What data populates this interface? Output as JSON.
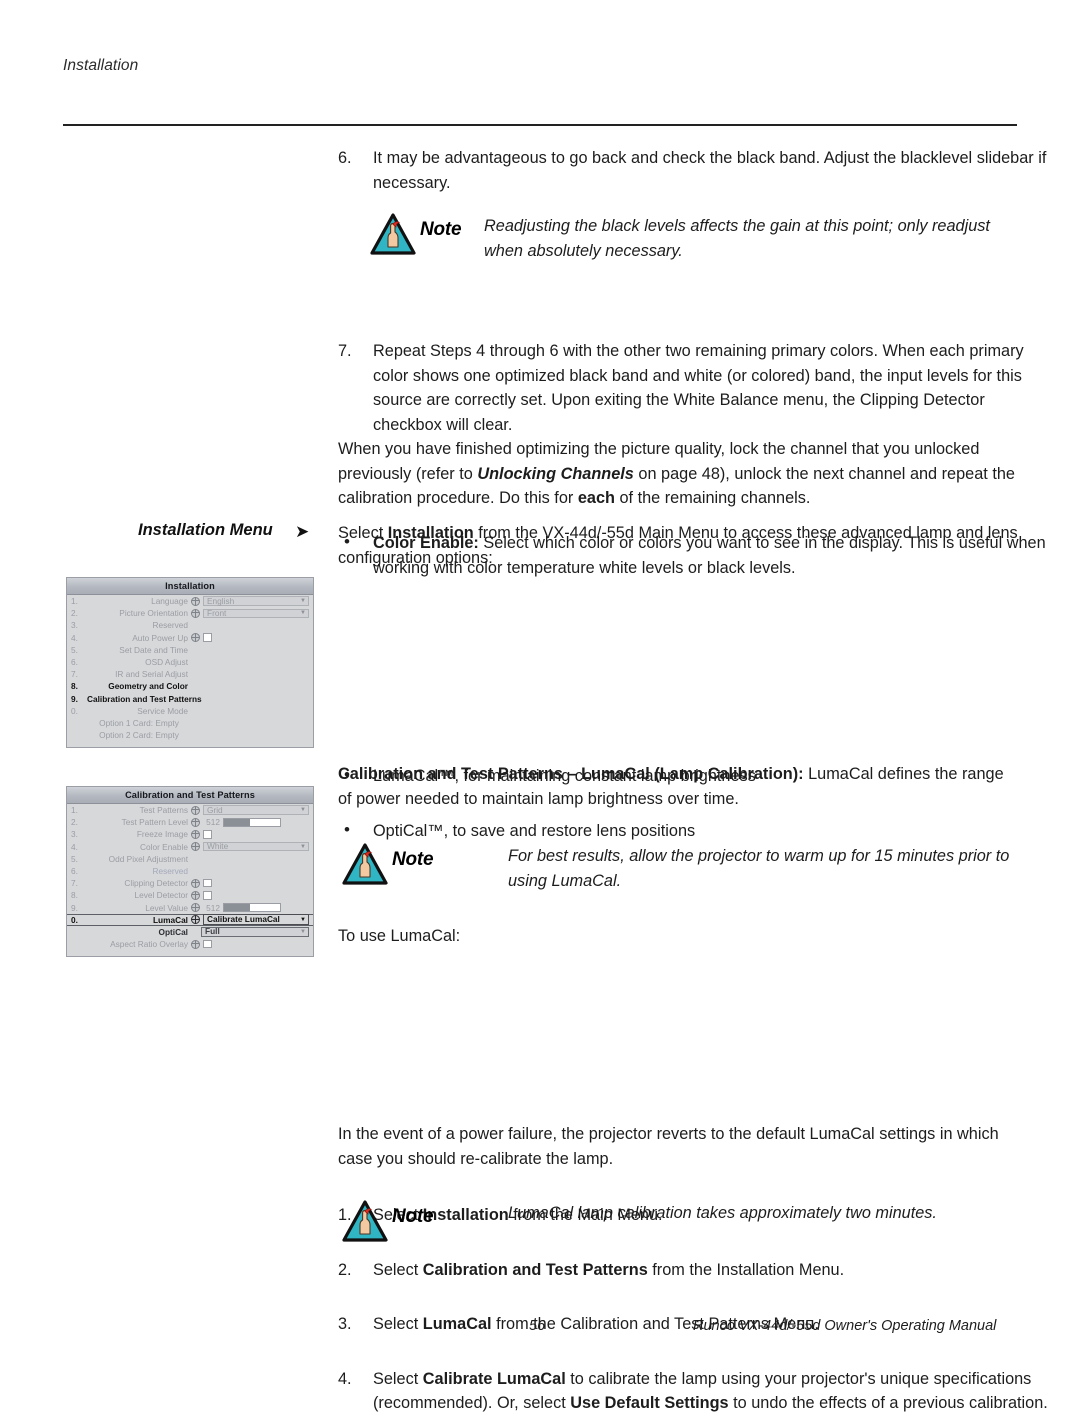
{
  "page": {
    "running_head": "Installation",
    "footer_page_number": "56",
    "footer_title": "Runco VX-44d/-55d Owner's Operating Manual"
  },
  "content": {
    "step6": {
      "marker": "6.",
      "text": "It may be advantageous to go back and check the black band. Adjust the blacklevel slidebar if necessary."
    },
    "note1": {
      "label": "Note",
      "text": "Readjusting the black levels affects the gain at this point; only readjust when absolutely necessary."
    },
    "step7": {
      "marker": "7.",
      "text": "Repeat Steps 4 through 6 with the other two remaining primary colors. When each primary color shows one optimized black band and white (or colored) band, the input levels for this source are correctly set. Upon exiting the White Balance menu, the Clipping Detector checkbox will clear."
    },
    "color_enable_bullet": {
      "marker": "•",
      "bold_lead": "Color Enable:",
      "text": " Select which color or colors you want to see in the display. This is useful when working with color temperature white levels or black levels."
    },
    "lock_paragraph": {
      "part1": "When you have finished optimizing the picture quality, lock the channel that you unlocked previously (refer to ",
      "bold_italic": "Unlocking Channels",
      "part2": " on page 48), unlock the next channel and repeat the calibration procedure. Do this for ",
      "bold": "each",
      "part3": " of the remaining channels."
    },
    "side_heading": "Installation Menu",
    "side_arrow_glyph": "➤",
    "install_intro": {
      "part1": "Select ",
      "bold": "Installation",
      "part2": " from the VX-44d/-55d Main Menu to access these advanced lamp and lens configuration options:"
    },
    "install_bullets": [
      {
        "marker": "•",
        "text": "LumaCal™, for maintaining constant lamp brightness"
      },
      {
        "marker": "•",
        "text": "OptiCal™, to save and restore lens positions"
      }
    ],
    "lumacal_heading": {
      "bold": "Calibration and Test Patterns – LumaCal (Lamp Calibration):",
      "text": " LumaCal defines the range of power needed to maintain lamp brightness over time."
    },
    "note2": {
      "label": "Note",
      "text": "For best results, allow the projector to warm up for 15 minutes prior to using LumaCal."
    },
    "to_use": "To use LumaCal:",
    "steps": [
      {
        "marker": "1.",
        "part1": "Select ",
        "bold": "Installation",
        "part2": " from the Main Menu."
      },
      {
        "marker": "2.",
        "part1": "Select ",
        "bold": "Calibration and Test Patterns",
        "part2": " from the Installation Menu."
      },
      {
        "marker": "3.",
        "part1": "Select ",
        "bold": "LumaCal",
        "part2": " from the Calibration and Test Patterns Menu."
      },
      {
        "marker": "4.",
        "part1": "Select ",
        "bold": "Calibrate LumaCal",
        "part2": " to calibrate the lamp using your projector's unique specifications (recommended). Or, select ",
        "bold2": "Use Default Settings",
        "part3": " to undo the effects of a previous calibration."
      }
    ],
    "power_failure": "In the event of a power failure, the projector reverts to the default LumaCal settings in which case you should re-calibrate the lamp.",
    "note3": {
      "label": "Note",
      "text": "LumaCal lamp calibration takes approximately two minutes."
    }
  },
  "osd_installation": {
    "title": "Installation",
    "rows": [
      {
        "idx": "1.",
        "label": "Language",
        "control": "dropdown",
        "value": "English"
      },
      {
        "idx": "2.",
        "label": "Picture Orientation",
        "control": "dropdown",
        "value": "Front"
      },
      {
        "idx": "3.",
        "label": "Reserved",
        "control": "none"
      },
      {
        "idx": "4.",
        "label": "Auto Power Up",
        "control": "checkbox"
      },
      {
        "idx": "5.",
        "label": "Set Date and Time",
        "control": "none"
      },
      {
        "idx": "6.",
        "label": "OSD Adjust",
        "control": "none"
      },
      {
        "idx": "7.",
        "label": "IR and Serial Adjust",
        "control": "none"
      },
      {
        "idx": "8.",
        "label": "Geometry and Color",
        "control": "none",
        "selected": true
      },
      {
        "idx": "9.",
        "label": "Calibration and Test Patterns",
        "control": "none",
        "selected": true
      },
      {
        "idx": "0.",
        "label": "Service Mode",
        "control": "none"
      },
      {
        "idx": "",
        "label": "Option 1 Card: Empty",
        "control": "none",
        "center": true
      },
      {
        "idx": "",
        "label": "Option 2 Card: Empty",
        "control": "none",
        "center": true
      }
    ]
  },
  "osd_calibration": {
    "title": "Calibration and Test Patterns",
    "rows": [
      {
        "idx": "1.",
        "label": "Test Patterns",
        "control": "dropdown",
        "value": "Grid"
      },
      {
        "idx": "2.",
        "label": "Test Pattern Level",
        "control": "slider",
        "value": "512"
      },
      {
        "idx": "3.",
        "label": "Freeze Image",
        "control": "checkbox"
      },
      {
        "idx": "4.",
        "label": "Color Enable",
        "control": "dropdown",
        "value": "White"
      },
      {
        "idx": "5.",
        "label": "Odd Pixel Adjustment",
        "control": "none"
      },
      {
        "idx": "6.",
        "label": "Reserved",
        "control": "none",
        "blue": true
      },
      {
        "idx": "7.",
        "label": "Clipping Detector",
        "control": "checkbox"
      },
      {
        "idx": "8.",
        "label": "Level Detector",
        "control": "checkbox"
      },
      {
        "idx": "9.",
        "label": "Level Value",
        "control": "slider",
        "value": "512"
      },
      {
        "idx": "0.",
        "label": "LumaCal",
        "control": "dropdown",
        "value": "Calibrate LumaCal",
        "highlight": true
      },
      {
        "idx": "",
        "label": "OptiCal",
        "control": "dropdown",
        "value": "Full",
        "mid": true,
        "noglobe": true
      },
      {
        "idx": "",
        "label": "Aspect Ratio Overlay",
        "control": "checkbox"
      }
    ]
  },
  "colors": {
    "note_triangle_fill": "#2fb5c4",
    "note_triangle_border": "#111111",
    "osd_background": "#d7d8da",
    "osd_title_bar": "#b4b8c0",
    "text": "#1d1d1d"
  }
}
